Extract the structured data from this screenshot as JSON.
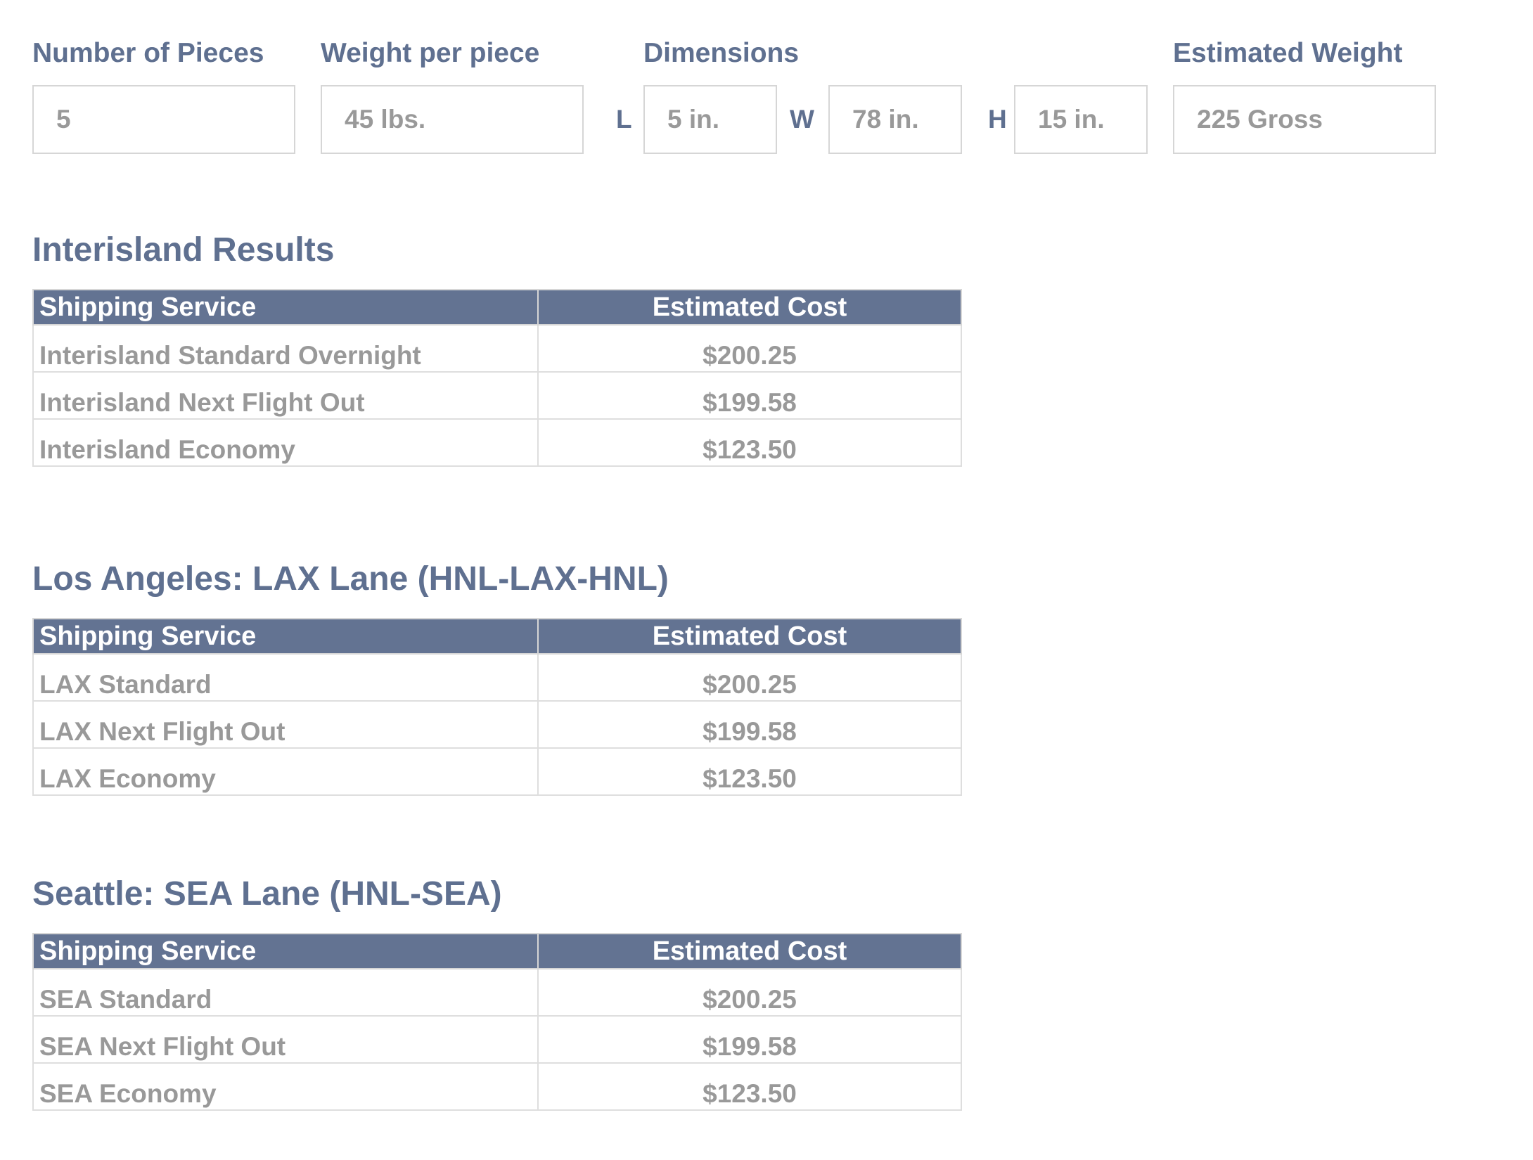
{
  "inputs": {
    "pieces": {
      "label": "Number of Pieces",
      "value": "5"
    },
    "weight_per_piece": {
      "label": "Weight per piece",
      "value": "45 lbs."
    },
    "dimensions": {
      "label": "Dimensions",
      "length": {
        "letter": "L",
        "value": "5 in."
      },
      "width": {
        "letter": "W",
        "value": "78 in."
      },
      "height": {
        "letter": "H",
        "value": "15 in."
      }
    },
    "estimated_weight": {
      "label": "Estimated Weight",
      "value": "225 Gross"
    }
  },
  "sections": [
    {
      "title": "Interisland Results",
      "headers": {
        "service": "Shipping Service",
        "cost": "Estimated Cost"
      },
      "rows": [
        {
          "service": "Interisland Standard Overnight",
          "cost": "$200.25"
        },
        {
          "service": "Interisland Next Flight Out",
          "cost": "$199.58"
        },
        {
          "service": "Interisland Economy",
          "cost": "$123.50"
        }
      ]
    },
    {
      "title": "Los Angeles: LAX Lane (HNL-LAX-HNL)",
      "headers": {
        "service": "Shipping Service",
        "cost": "Estimated Cost"
      },
      "rows": [
        {
          "service": "LAX Standard",
          "cost": "$200.25"
        },
        {
          "service": "LAX Next Flight Out",
          "cost": "$199.58"
        },
        {
          "service": "LAX Economy",
          "cost": "$123.50"
        }
      ]
    },
    {
      "title": "Seattle: SEA Lane (HNL-SEA)",
      "headers": {
        "service": "Shipping Service",
        "cost": "Estimated Cost"
      },
      "rows": [
        {
          "service": "SEA Standard",
          "cost": "$200.25"
        },
        {
          "service": "SEA Next Flight Out",
          "cost": "$199.58"
        },
        {
          "service": "SEA Economy",
          "cost": "$123.50"
        }
      ]
    }
  ],
  "colors": {
    "label": "#5f7090",
    "header_bg": "#637392",
    "value_text": "#999999",
    "border": "#d6d6d6"
  }
}
